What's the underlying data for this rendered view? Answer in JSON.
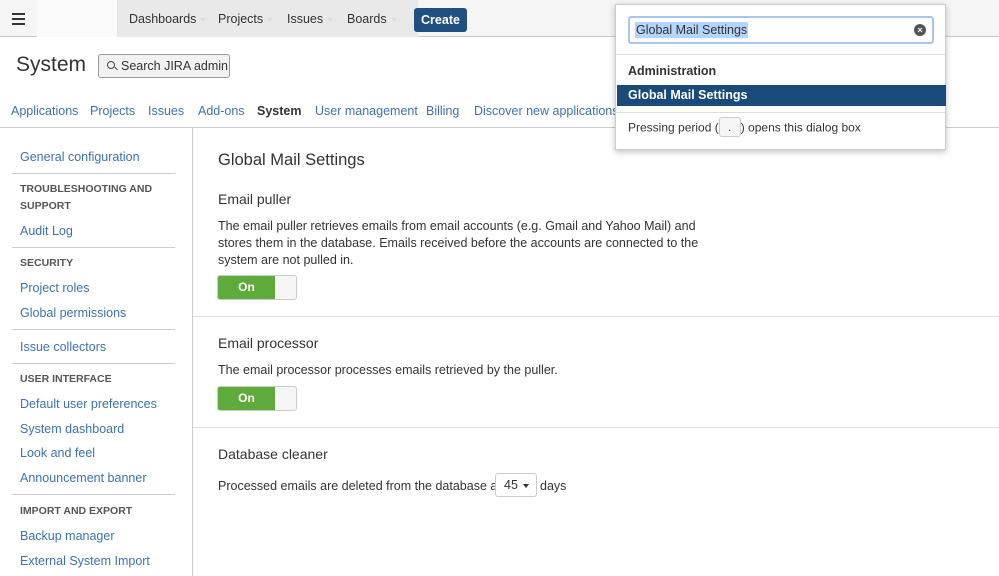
{
  "topnav": {
    "items": [
      {
        "label": "Dashboards"
      },
      {
        "label": "Projects"
      },
      {
        "label": "Issues"
      },
      {
        "label": "Boards"
      }
    ],
    "create_label": "Create"
  },
  "header": {
    "title": "System",
    "search_button_label": "Search JIRA admin"
  },
  "tabs": [
    {
      "label": "Applications"
    },
    {
      "label": "Projects"
    },
    {
      "label": "Issues"
    },
    {
      "label": "Add-ons"
    },
    {
      "label": "System"
    },
    {
      "label": "User management"
    },
    {
      "label": "Billing"
    },
    {
      "label": "Discover new applications"
    }
  ],
  "sidebar": {
    "general": "General configuration",
    "troubleshooting_head": "TROUBLESHOOTING AND SUPPORT",
    "audit_log": "Audit Log",
    "security_head": "SECURITY",
    "project_roles": "Project roles",
    "global_permissions": "Global permissions",
    "issue_collectors": "Issue collectors",
    "ui_head": "USER INTERFACE",
    "default_prefs": "Default user preferences",
    "system_dashboard": "System dashboard",
    "look_feel": "Look and feel",
    "announcement": "Announcement banner",
    "import_head": "IMPORT AND EXPORT",
    "backup": "Backup manager",
    "external_import": "External System Import"
  },
  "main": {
    "title": "Global Mail Settings",
    "puller": {
      "title": "Email puller",
      "description": "The email puller retrieves emails from email accounts (e.g. Gmail and Yahoo Mail) and stores them in the database. Emails received before the accounts are connected to the system are not pulled in.",
      "toggle_label": "On"
    },
    "processor": {
      "title": "Email processor",
      "description": "The email processor processes emails retrieved by the puller.",
      "toggle_label": "On"
    },
    "cleaner": {
      "title": "Database cleaner",
      "text_before": "Processed emails are deleted from the database after",
      "days_value": "45",
      "text_after": "days"
    }
  },
  "dialog": {
    "search_value": "Global Mail Settings",
    "section_head": "Administration",
    "result": "Global Mail Settings",
    "hint_before": "Pressing period (",
    "hint_key": ".",
    "hint_after": ") opens this dialog box"
  },
  "colors": {
    "link": "#3b73af",
    "create": "#205081",
    "toggle_on": "#5eab3b",
    "selected_result": "#1a4a7a"
  }
}
